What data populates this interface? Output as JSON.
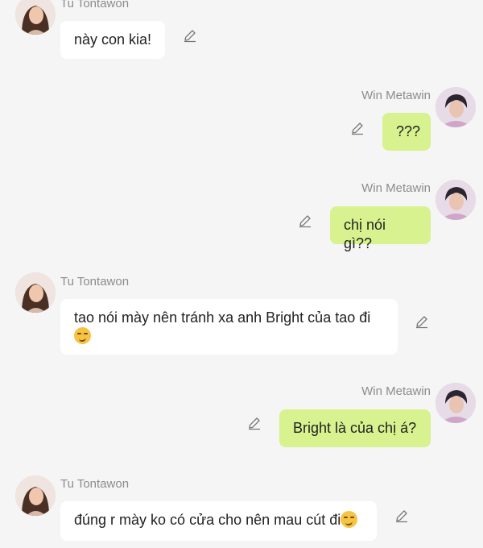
{
  "users": {
    "left_name": "Tu Tontawon",
    "right_name": "Win Metawin"
  },
  "messages": [
    {
      "sender": "Tu Tontawon",
      "side": "left",
      "text": "này con kia!"
    },
    {
      "sender": "Win Metawin",
      "side": "right",
      "text": "???"
    },
    {
      "sender": "Win Metawin",
      "side": "right",
      "text": "chị nói gì??"
    },
    {
      "sender": "Tu Tontawon",
      "side": "left",
      "text": "tao nói mày nên tránh xa anh Bright của tao đi",
      "emoji": "smirk"
    },
    {
      "sender": "Win Metawin",
      "side": "right",
      "text": "Bright là của chị á?"
    },
    {
      "sender": "Tu Tontawon",
      "side": "left",
      "text": "đúng r mày ko có cửa cho nên mau cút đi",
      "emoji": "smirk"
    }
  ],
  "icons": {
    "edit": "pencil-edit-icon",
    "emoji": "smirking-face-emoji"
  },
  "colors": {
    "background": "#f5f5f5",
    "left_bubble": "#ffffff",
    "right_bubble": "#d7f28f",
    "name_text": "#8c8c8c"
  }
}
